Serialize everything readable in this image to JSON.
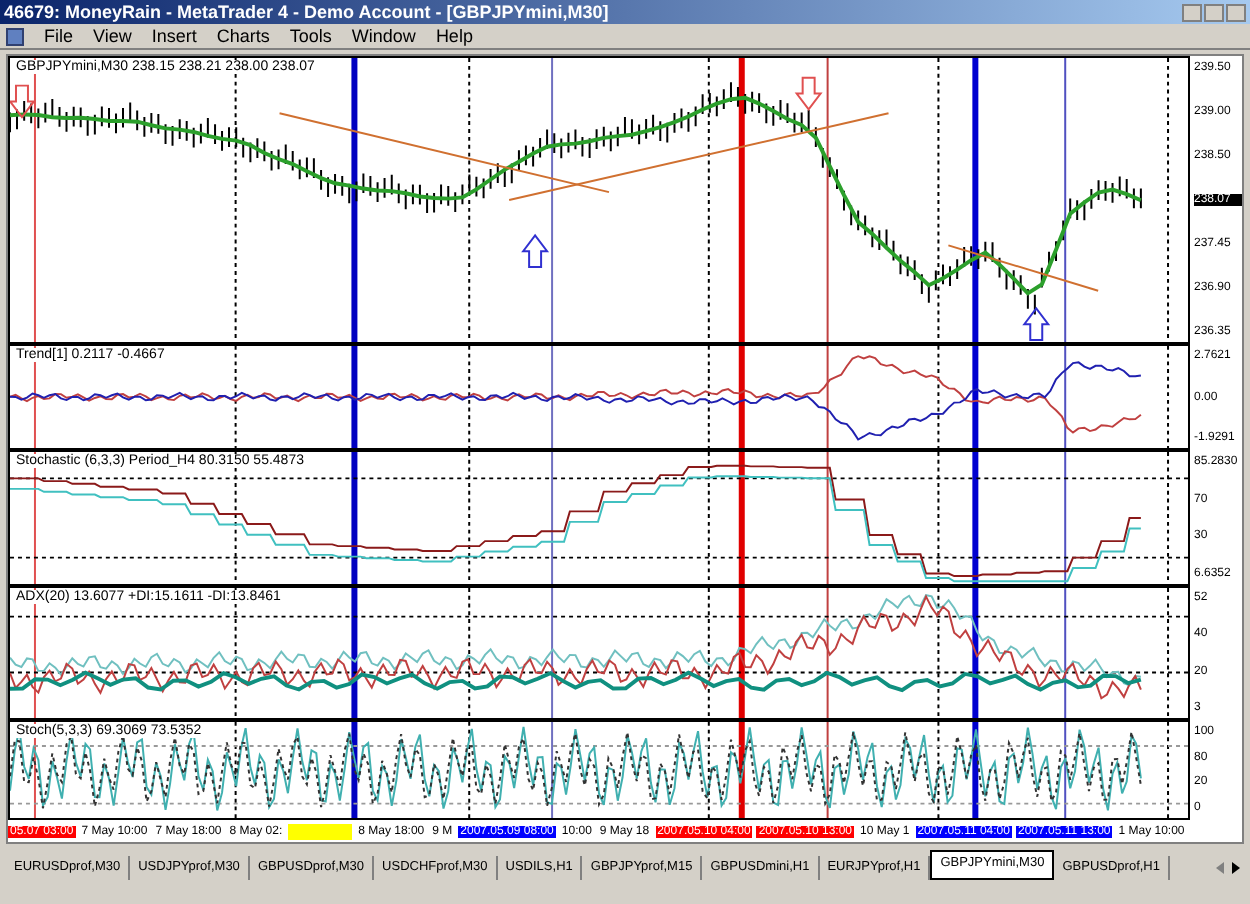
{
  "window": {
    "title": "46679: MoneyRain - MetaTrader 4 - Demo Account - [GBPJPYmini,M30]"
  },
  "menu": [
    "File",
    "View",
    "Insert",
    "Charts",
    "Tools",
    "Window",
    "Help"
  ],
  "panels": [
    {
      "kind": "price",
      "label": "GBPJPYmini,M30  238.15 238.21 238.00 238.07",
      "axis": [
        {
          "text": "239.50",
          "current": false
        },
        {
          "text": "239.00",
          "current": false
        },
        {
          "text": "238.50",
          "current": false
        },
        {
          "text": "238.07",
          "current": true
        },
        {
          "text": "237.45",
          "current": false
        },
        {
          "text": "236.90",
          "current": false
        },
        {
          "text": "236.35",
          "current": false
        }
      ]
    },
    {
      "kind": "trend",
      "label": "Trend[1] 0.2117 -0.4667",
      "axis": [
        {
          "text": "2.7621",
          "current": false
        },
        {
          "text": "0.00",
          "current": false
        },
        {
          "text": "-1.9291",
          "current": false
        }
      ]
    },
    {
      "kind": "stochastic",
      "label": "Stochastic (6,3,3) Period_H4 80.3150 55.4873",
      "axis": [
        {
          "text": "85.2830",
          "current": false
        },
        {
          "text": "70",
          "current": false
        },
        {
          "text": "30",
          "current": false
        },
        {
          "text": "6.6352",
          "current": false
        }
      ]
    },
    {
      "kind": "adx",
      "label": "ADX(20) 13.6077 +DI:15.1611 -DI:13.8461",
      "axis": [
        {
          "text": "52",
          "current": false
        },
        {
          "text": "40",
          "current": false
        },
        {
          "text": "20",
          "current": false
        },
        {
          "text": "3",
          "current": false
        }
      ]
    },
    {
      "kind": "stoch",
      "label": "Stoch(5,3,3) 69.3069 73.5352",
      "axis": [
        {
          "text": "100",
          "current": false
        },
        {
          "text": "80",
          "current": false
        },
        {
          "text": "20",
          "current": false
        },
        {
          "text": "0",
          "current": false
        }
      ]
    }
  ],
  "time_axis": [
    {
      "text": "05.07 03:00",
      "color": "#ff0000"
    },
    {
      "text": "7 May 10:00"
    },
    {
      "text": "7 May 18:00"
    },
    {
      "text": "8 May 02:"
    },
    {
      "color": "#ffff00"
    },
    {
      "text": "8 May 18:00"
    },
    {
      "text": "9 M"
    },
    {
      "text": "2007.05.09 08:00",
      "color": "#0000ff"
    },
    {
      "text": "10:00"
    },
    {
      "text": "9 May 18"
    },
    {
      "text": "2007.05.10 04:00",
      "color": "#ff0000"
    },
    {
      "text": "2007.05.10 13:00",
      "color": "#ff0000"
    },
    {
      "text": "10 May 1"
    },
    {
      "text": "2007.05.11 04:00",
      "color": "#0000ff"
    },
    {
      "text": "2007.05.11 13:00",
      "color": "#0000ff"
    },
    {
      "text": "1 May 10:00"
    }
  ],
  "tabs": [
    {
      "label": "EURUSDprof,M30",
      "selected": false
    },
    {
      "label": "USDJPYprof,M30",
      "selected": false
    },
    {
      "label": "GBPUSDprof,M30",
      "selected": false
    },
    {
      "label": "USDCHFprof,M30",
      "selected": false
    },
    {
      "label": "USDILS,H1",
      "selected": false
    },
    {
      "label": "GBPJPYprof,M15",
      "selected": false
    },
    {
      "label": "GBPUSDmini,H1",
      "selected": false
    },
    {
      "label": "EURJPYprof,H1",
      "selected": false
    },
    {
      "label": "GBPJPYmini,M30",
      "selected": true
    },
    {
      "label": "GBPUSDprof,H1",
      "selected": false
    }
  ]
}
